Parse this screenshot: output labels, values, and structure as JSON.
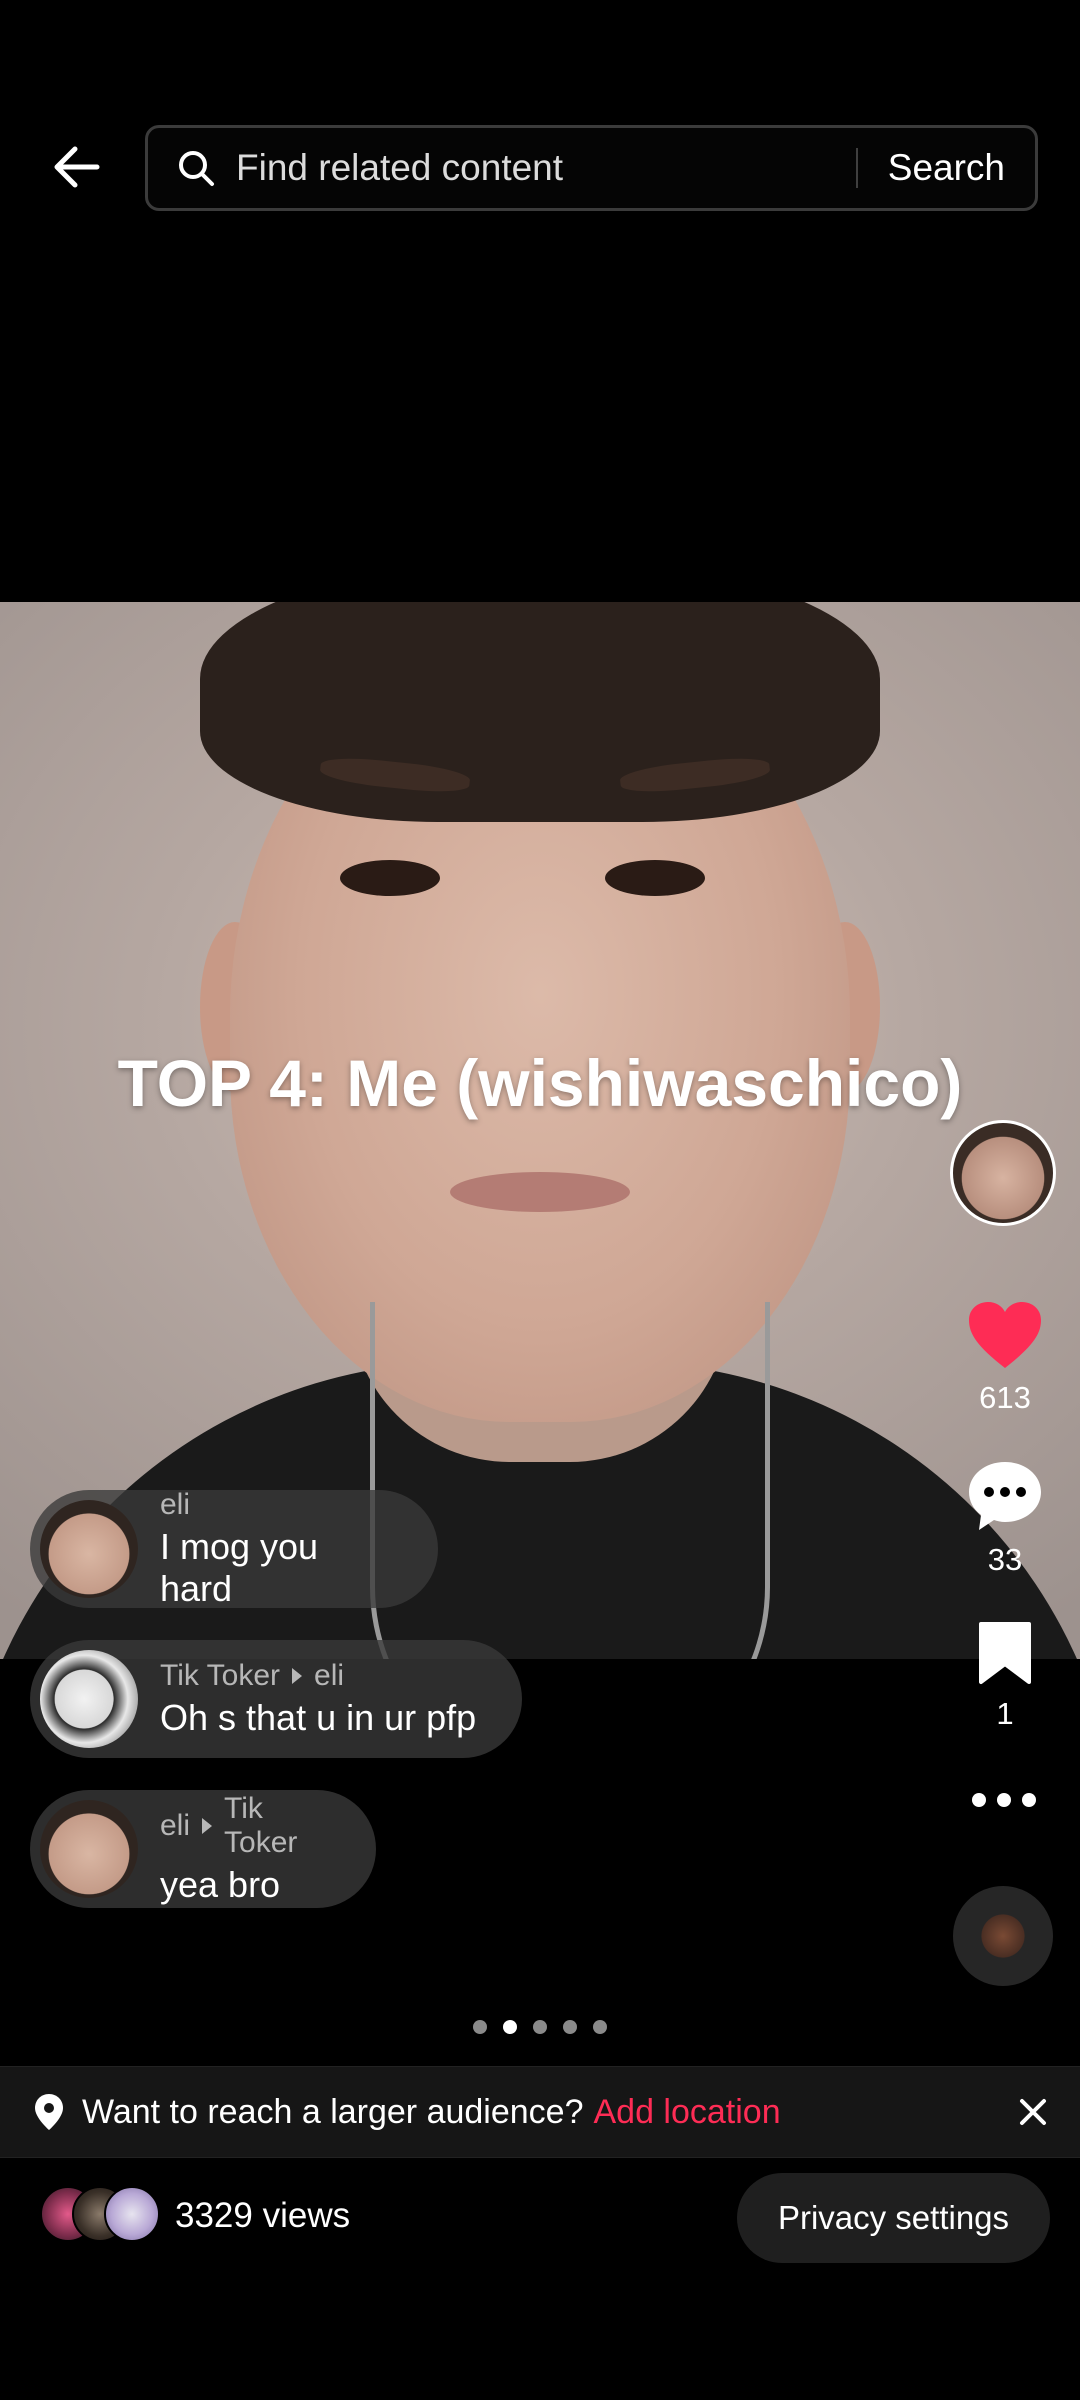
{
  "header": {
    "search_placeholder": "Find related content",
    "search_button": "Search"
  },
  "video": {
    "overlay_title": "TOP 4: Me (wishiwaschico)"
  },
  "actions": {
    "likes": "613",
    "comments": "33",
    "saves": "1",
    "like_color": "#fe2c55"
  },
  "comments": [
    {
      "author": "eli",
      "reply_to": "",
      "text": "I mog you hard"
    },
    {
      "author": "Tik Toker",
      "reply_to": "eli",
      "text": "Oh s that u in ur pfp"
    },
    {
      "author": "eli",
      "reply_to": "Tik Toker",
      "text": "yea bro"
    }
  ],
  "pagination": {
    "total": 5,
    "active": 2
  },
  "location_banner": {
    "text": "Want to reach a larger audience?",
    "link": "Add location",
    "link_color": "#fe2c55"
  },
  "footer": {
    "views": "3329 views",
    "privacy_button": "Privacy settings"
  }
}
